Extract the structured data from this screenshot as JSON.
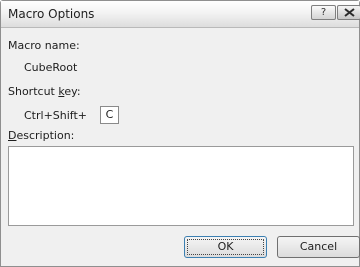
{
  "window": {
    "title": "Macro Options",
    "help_label": "?",
    "close_icon": "close-icon"
  },
  "macro": {
    "name_label": "Macro name:",
    "name_value": "CubeRoot"
  },
  "shortcut": {
    "label_prefix": "Shortcut ",
    "label_accel": "k",
    "label_suffix": "ey:",
    "modifier_text": "Ctrl+Shift+",
    "key_value": "C"
  },
  "description": {
    "label_accel": "D",
    "label_rest": "escription:",
    "value": ""
  },
  "buttons": {
    "ok_label": "OK",
    "cancel_label": "Cancel"
  }
}
